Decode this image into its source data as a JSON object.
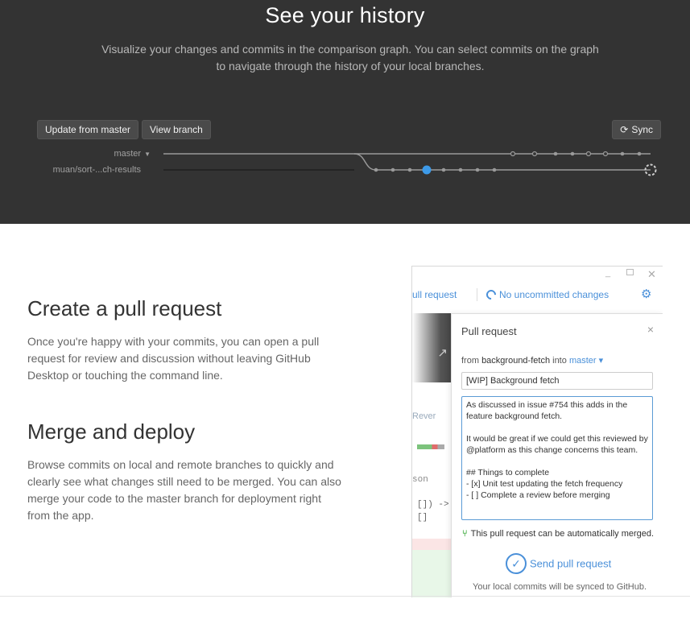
{
  "hero": {
    "title": "See your history",
    "description": "Visualize your changes and commits in the comparison graph. You can select commits on the graph to navigate through the history of your local branches.",
    "buttons": {
      "update_from_master": "Update from master",
      "view_branch": "View branch",
      "sync": "Sync"
    },
    "icons": {
      "sync": "sync-icon",
      "branch_caret": "caret-down-icon"
    },
    "branches": {
      "master": "master",
      "feature": "muan/sort-...ch-results"
    },
    "colors": {
      "background": "#333333",
      "selected_commit": "#3d9ae8",
      "graph_line": "#9a9a9a"
    }
  },
  "sections": {
    "pull_request": {
      "heading": "Create a pull request",
      "text": "Once you're happy with your commits, you can open a pull request for review and discussion without leaving GitHub Desktop or touching the command line."
    },
    "merge": {
      "heading": "Merge and deploy",
      "text": "Browse commits on local and remote branches to quickly and clearly see what changes still need to be merged. You can also merge your code to the master branch for deployment right from the app."
    }
  },
  "app": {
    "window_controls": {
      "minimize": "_",
      "maximize": "",
      "close": "✕"
    },
    "toolbar": {
      "pull_request_tab": "ull request",
      "uncommitted": "No uncommitted changes",
      "gear_icon": "gear-icon"
    },
    "background": {
      "revert": "Rever",
      "json_fragment": "son",
      "code_line1": "[]) ->",
      "code_line2": "[]"
    },
    "pr_panel": {
      "title": "Pull request",
      "close": "×",
      "from_prefix": "from",
      "from_branch": "background-fetch",
      "into_word": "into",
      "target_branch": "master ▾",
      "title_value": "[WIP] Background fetch",
      "body_value": "As discussed in issue #754 this adds in the feature background fetch.\n\nIt would be great if we could get this reviewed by @platform as this change concerns this team.\n\n## Things to complete\n- [x] Unit test updating the fetch frequency\n- [ ] Complete a review before merging",
      "merge_status": "This pull request can be automatically merged.",
      "send_button": "Send pull request",
      "synced_note": "Your local commits will be synced to GitHub."
    }
  }
}
